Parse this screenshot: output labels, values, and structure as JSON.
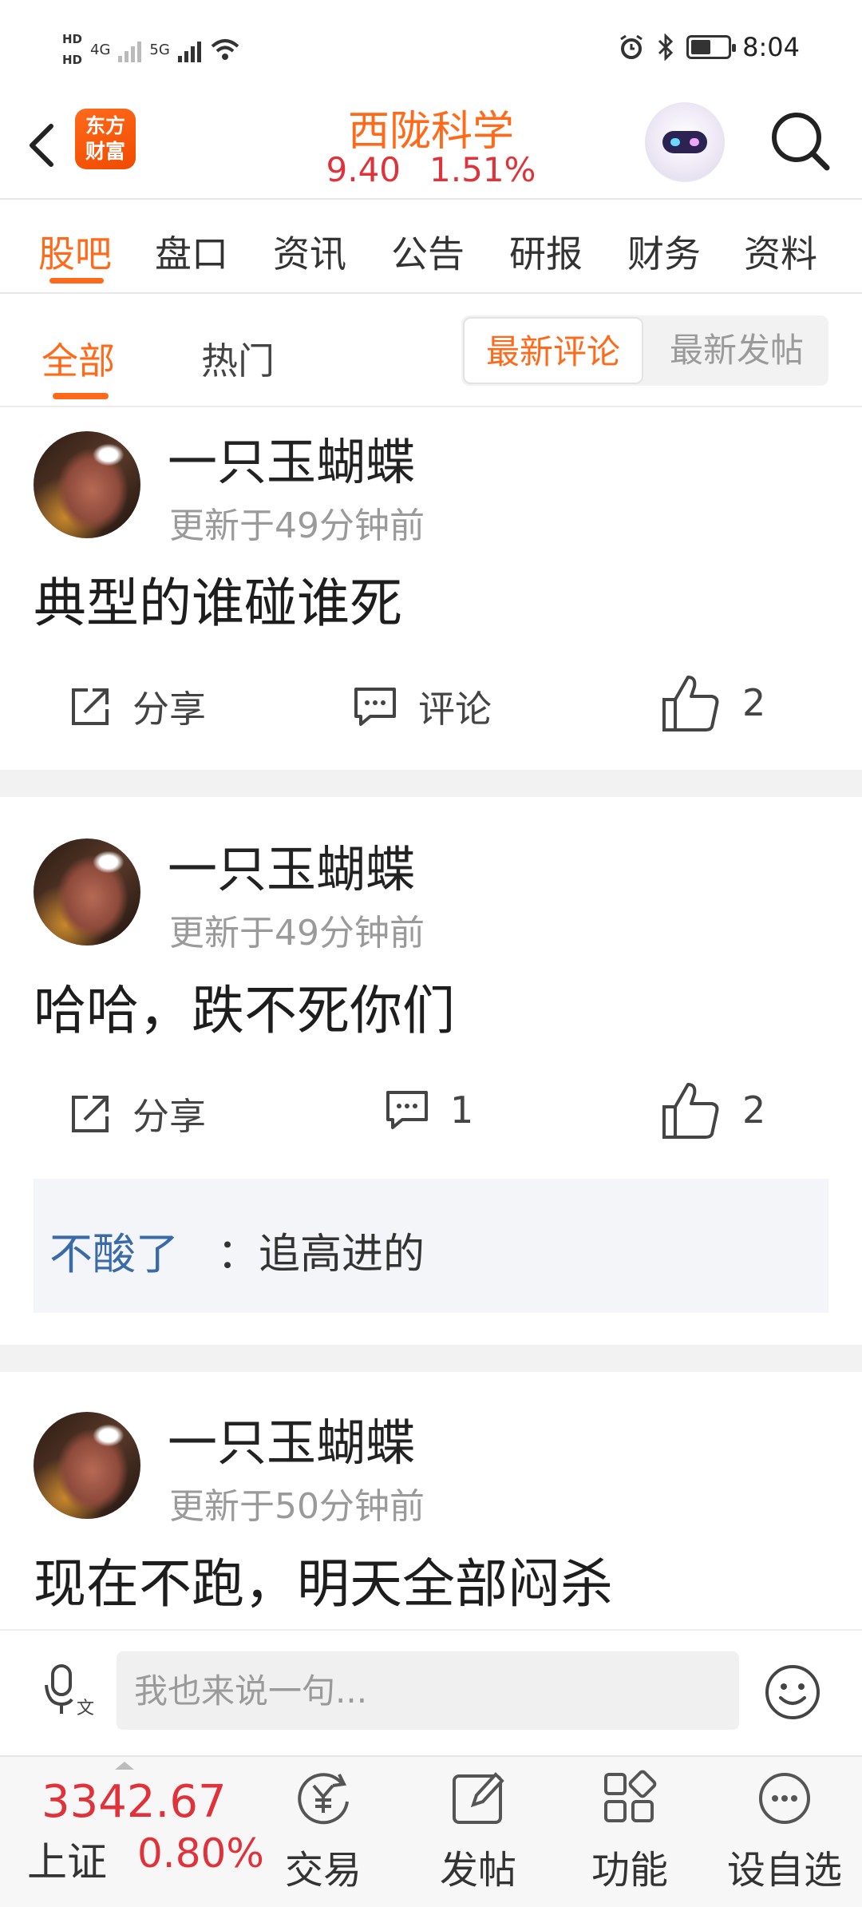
{
  "status_bar": {
    "time": "8:04",
    "hd1": "HD",
    "hd2": "HD",
    "net1": "4G",
    "net2": "5G",
    "battery_level": 0.55
  },
  "header": {
    "logo_line1": "东方",
    "logo_line2": "财富",
    "stock_name": "西陇科学",
    "price": "9.40",
    "change_pct": "1.51%"
  },
  "tabs": [
    "股吧",
    "盘口",
    "资讯",
    "公告",
    "研报",
    "财务",
    "资料"
  ],
  "active_tab": "股吧",
  "filter": {
    "all": "全部",
    "hot": "热门",
    "latest_comment": "最新评论",
    "latest_post": "最新发帖"
  },
  "posts": [
    {
      "author": "一只玉蝴蝶",
      "time": "更新于49分钟前",
      "content": "典型的谁碰谁死",
      "share_label": "分享",
      "comment_label": "评论",
      "likes": "2"
    },
    {
      "author": "一只玉蝴蝶",
      "time": "更新于49分钟前",
      "content": "哈哈，跌不死你们",
      "share_label": "分享",
      "comment_label": "1",
      "likes": "2",
      "reply": {
        "name": "不酸了",
        "text": "：追高进的"
      }
    },
    {
      "author": "一只玉蝴蝶",
      "time": "更新于50分钟前",
      "content": "现在不跑，明天全部闷杀"
    }
  ],
  "comment_bar": {
    "placeholder": "我也来说一句..."
  },
  "bottom_bar": {
    "index_value": "3342.67",
    "index_name": "上证",
    "index_pct": "0.80%",
    "trade": "交易",
    "post": "发帖",
    "functions": "功能",
    "watchlist": "设自选"
  },
  "colors": {
    "accent": "#ff6a1a",
    "up_red": "#e0323a",
    "link_blue": "#3b6aa9"
  }
}
